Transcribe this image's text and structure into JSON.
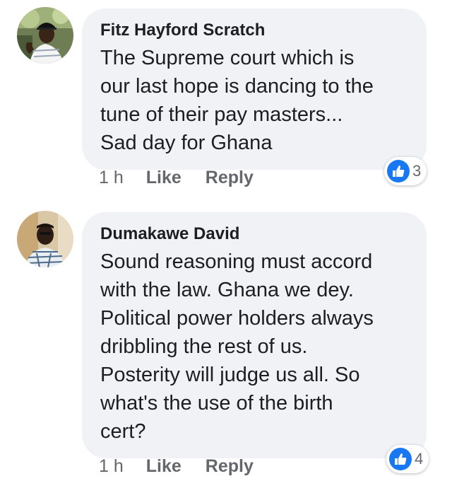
{
  "comments": [
    {
      "author": "Fitz Hayford Scratch",
      "text": "The Supreme court which is\nour last hope is dancing to the\ntune of their pay masters...\nSad day for Ghana",
      "time": "1 h",
      "like_label": "Like",
      "reply_label": "Reply",
      "reaction_count": "3",
      "reaction_icon": "thumbs-up-icon"
    },
    {
      "author": "Dumakawe David",
      "text": "Sound reasoning must accord\nwith the law. Ghana we dey.\nPolitical power holders  always\ndribbling the rest of us.\nPosterity will judge us all. So\nwhat's the use of the birth\ncert?",
      "time": "1 h",
      "like_label": "Like",
      "reply_label": "Reply",
      "reaction_count": "4",
      "reaction_icon": "thumbs-up-icon"
    }
  ],
  "colors": {
    "bubble_bg": "#f0f2f5",
    "meta_text": "#65676b",
    "like_blue": "#1877f2"
  }
}
